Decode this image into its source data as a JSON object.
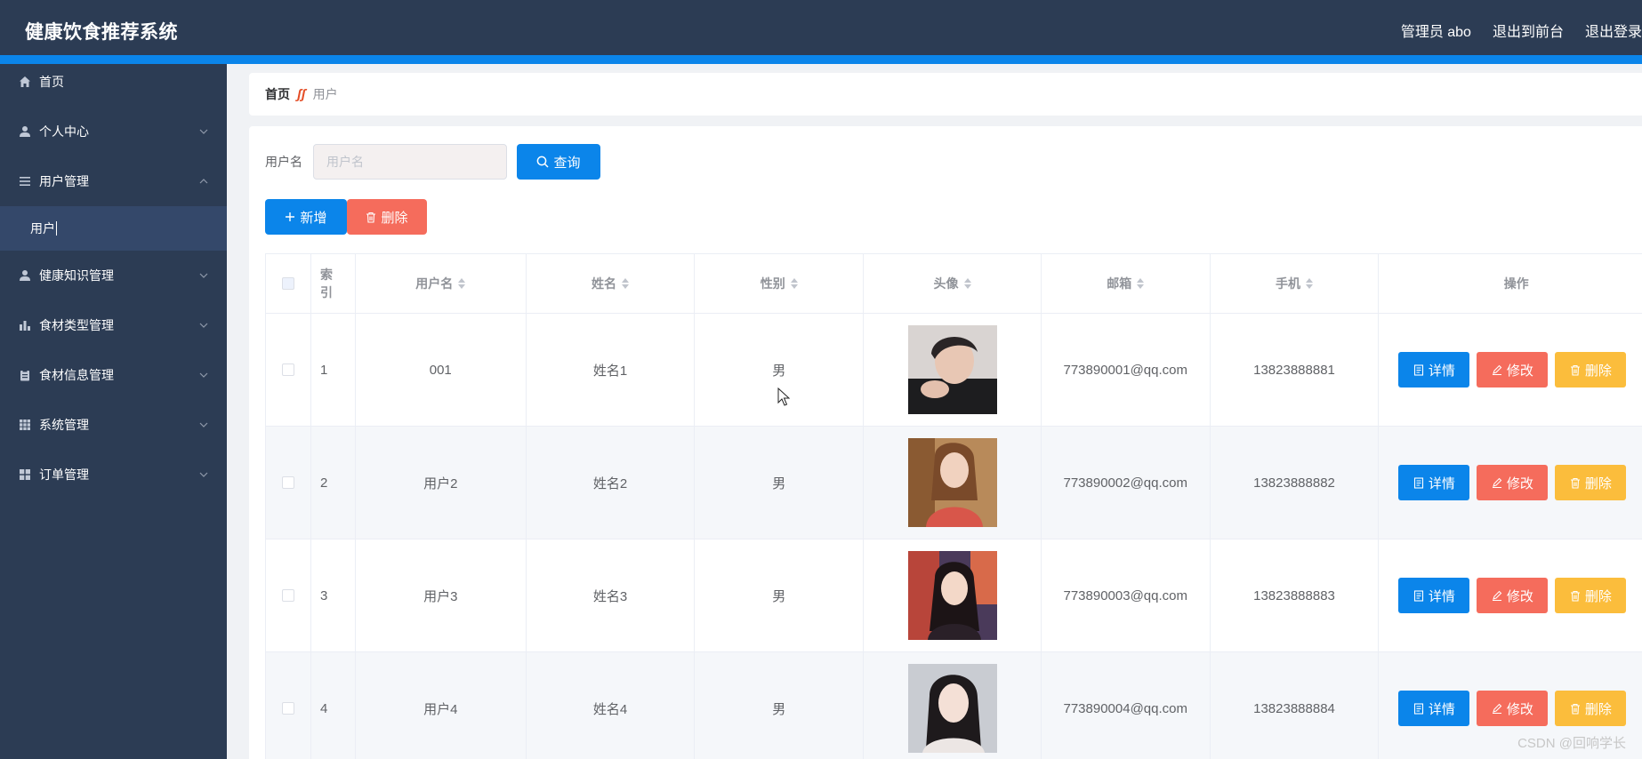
{
  "header": {
    "title": "健康饮食推荐系统",
    "admin_label": "管理员 abo",
    "front_label": "退出到前台",
    "logout_label": "退出登录"
  },
  "sidebar": {
    "items": [
      {
        "label": "首页",
        "icon": "home-icon"
      },
      {
        "label": "个人中心",
        "icon": "user-icon"
      },
      {
        "label": "用户管理",
        "icon": "list-icon",
        "expanded": true,
        "children": [
          {
            "label": "用户"
          }
        ]
      },
      {
        "label": "健康知识管理",
        "icon": "user-icon"
      },
      {
        "label": "食材类型管理",
        "icon": "bar-chart-icon"
      },
      {
        "label": "食材信息管理",
        "icon": "clipboard-icon"
      },
      {
        "label": "系统管理",
        "icon": "grid-icon"
      },
      {
        "label": "订单管理",
        "icon": "apps-icon"
      }
    ]
  },
  "breadcrumb": {
    "home": "首页",
    "current": "用户"
  },
  "search": {
    "label": "用户名",
    "placeholder": "用户名",
    "query_label": "查询"
  },
  "actions": {
    "add_label": "新增",
    "delete_label": "删除"
  },
  "table": {
    "headers": [
      "索引",
      "用户名",
      "姓名",
      "性别",
      "头像",
      "邮箱",
      "手机",
      "操作"
    ],
    "rows": [
      {
        "index": "1",
        "username": "001",
        "name": "姓名1",
        "sex": "男",
        "email": "773890001@qq.com",
        "phone": "13823888881"
      },
      {
        "index": "2",
        "username": "用户2",
        "name": "姓名2",
        "sex": "男",
        "email": "773890002@qq.com",
        "phone": "13823888882"
      },
      {
        "index": "3",
        "username": "用户3",
        "name": "姓名3",
        "sex": "男",
        "email": "773890003@qq.com",
        "phone": "13823888883"
      },
      {
        "index": "4",
        "username": "用户4",
        "name": "姓名4",
        "sex": "男",
        "email": "773890004@qq.com",
        "phone": "13823888884"
      }
    ],
    "op_labels": {
      "detail": "详情",
      "edit": "修改",
      "delete": "删除"
    }
  },
  "watermark": "CSDN @回响学长",
  "colors": {
    "header_bg": "#2c3c54",
    "accent_blue": "#0b85ea",
    "danger": "#f56c5c",
    "warning": "#fbbd3c"
  }
}
